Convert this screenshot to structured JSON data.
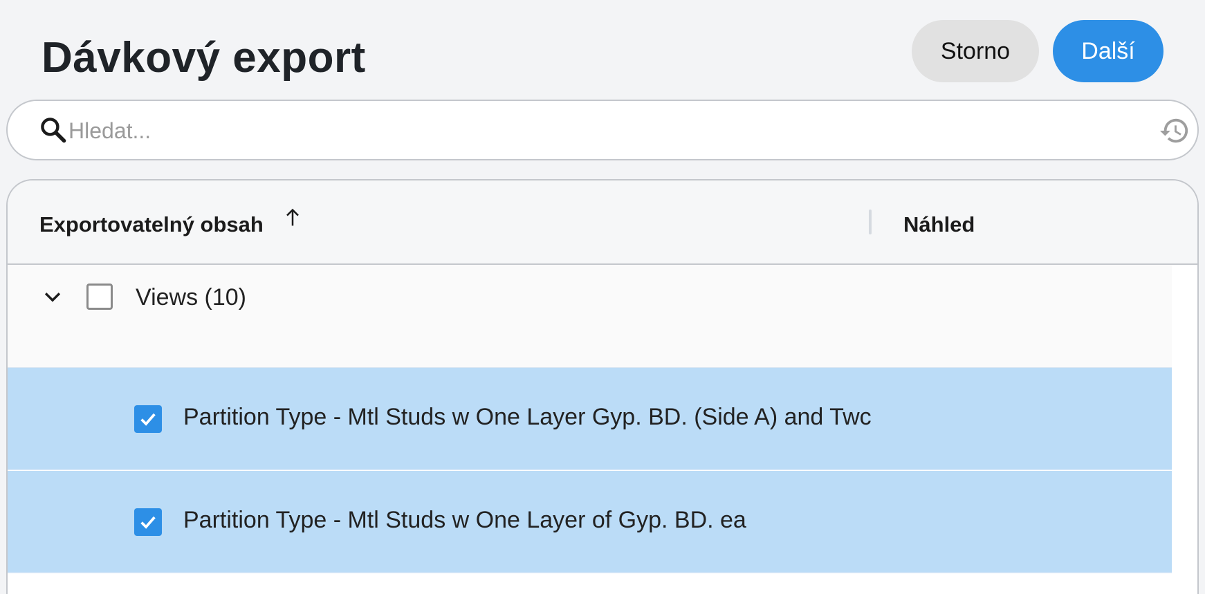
{
  "header": {
    "title": "Dávkový export",
    "cancel_label": "Storno",
    "next_label": "Další"
  },
  "search": {
    "placeholder": "Hledat...",
    "value": "",
    "icon": "search-icon",
    "history_icon": "history-icon"
  },
  "table": {
    "columns": [
      {
        "label": "Exportovatelný obsah",
        "sort": "ascending"
      },
      {
        "label": "Náhled"
      }
    ],
    "group": {
      "label": "Views (10)",
      "expanded": true,
      "checked": false
    },
    "rows": [
      {
        "label": "Partition Type - Mtl Studs w One Layer Gyp. BD. (Side A) and Twc",
        "checked": true,
        "selected": true
      },
      {
        "label": "Partition Type - Mtl Studs w One Layer of Gyp. BD. ea",
        "checked": true,
        "selected": true
      }
    ]
  },
  "colors": {
    "accent": "#2d8fe6",
    "selected_row": "#bbdcf7",
    "cancel_bg": "#e1e1e1"
  }
}
